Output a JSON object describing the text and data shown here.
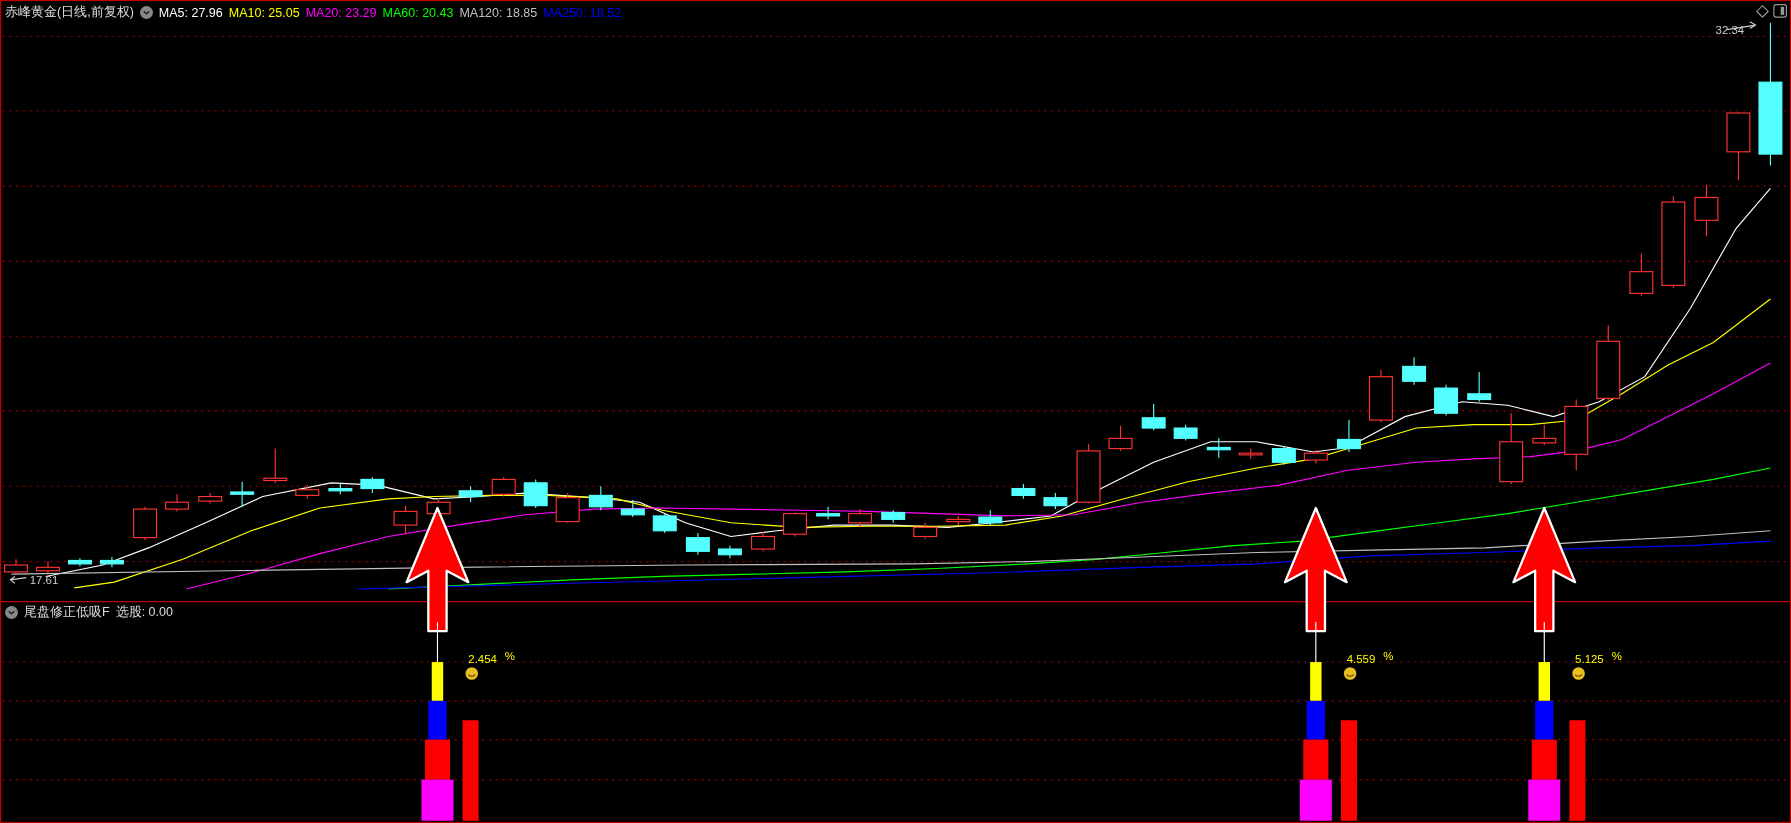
{
  "header": {
    "title": "赤峰黄金(日线,前复权)",
    "ma": [
      {
        "label": "MA5: 27.96",
        "color": "#ffffff"
      },
      {
        "label": "MA10: 25.05",
        "color": "#ffff00"
      },
      {
        "label": "MA20: 23.29",
        "color": "#ff00ff"
      },
      {
        "label": "MA60: 20.43",
        "color": "#00ff00"
      },
      {
        "label": "MA120: 18.85",
        "color": "#c0c0c0"
      },
      {
        "label": "MA250: 18.52",
        "color": "#0000ff"
      }
    ]
  },
  "price_labels": {
    "high": "32.34",
    "low": "17.61"
  },
  "indicator": {
    "name": "尾盘修正低吸F",
    "reading": "选股: 0.00",
    "signals": [
      {
        "value": "2.454",
        "unit": "%"
      },
      {
        "value": "4.559",
        "unit": "%"
      },
      {
        "value": "5.125",
        "unit": "%"
      }
    ]
  }
}
